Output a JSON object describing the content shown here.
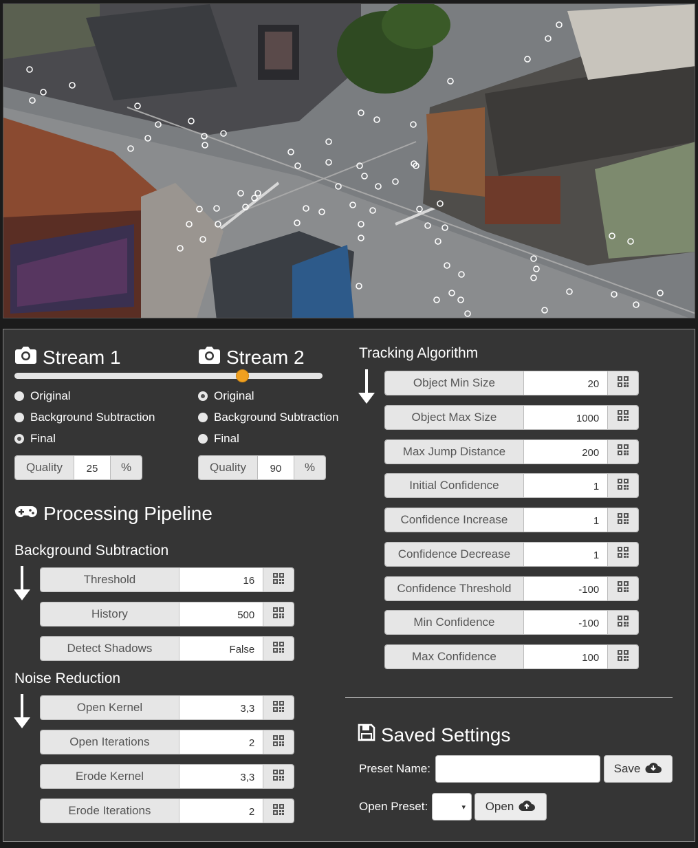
{
  "stream1": {
    "title": "Stream 1",
    "options": [
      "Original",
      "Background Subtraction",
      "Final"
    ],
    "selected": "Final",
    "quality_label": "Quality",
    "quality_value": "25",
    "quality_unit": "%"
  },
  "stream2": {
    "title": "Stream 2",
    "options": [
      "Original",
      "Background Subtraction",
      "Final"
    ],
    "selected": "Original",
    "quality_label": "Quality",
    "quality_value": "90",
    "quality_unit": "%"
  },
  "stream_slider": {
    "value_fraction": 0.74
  },
  "pipeline": {
    "title": "Processing Pipeline",
    "background_subtraction": {
      "title": "Background Subtraction",
      "params": [
        {
          "label": "Threshold",
          "value": "16"
        },
        {
          "label": "History",
          "value": "500"
        },
        {
          "label": "Detect Shadows",
          "value": "False"
        }
      ]
    },
    "noise_reduction": {
      "title": "Noise Reduction",
      "params": [
        {
          "label": "Open Kernel",
          "value": "3,3"
        },
        {
          "label": "Open Iterations",
          "value": "2"
        },
        {
          "label": "Erode Kernel",
          "value": "3,3"
        },
        {
          "label": "Erode Iterations",
          "value": "2"
        }
      ]
    }
  },
  "tracking": {
    "title": "Tracking Algorithm",
    "params": [
      {
        "label": "Object Min Size",
        "value": "20"
      },
      {
        "label": "Object Max Size",
        "value": "1000"
      },
      {
        "label": "Max Jump Distance",
        "value": "200"
      },
      {
        "label": "Initial Confidence",
        "value": "1"
      },
      {
        "label": "Confidence Increase",
        "value": "1"
      },
      {
        "label": "Confidence Decrease",
        "value": "1"
      },
      {
        "label": "Confidence Threshold",
        "value": "-100"
      },
      {
        "label": "Min Confidence",
        "value": "-100"
      },
      {
        "label": "Max Confidence",
        "value": "100"
      }
    ]
  },
  "saved": {
    "title": "Saved Settings",
    "preset_name_label": "Preset Name:",
    "preset_name_value": "",
    "save_label": "Save",
    "open_preset_label": "Open Preset:",
    "open_preset_value": "",
    "open_label": "Open"
  },
  "icons": {
    "camera": "camera-icon",
    "gamepad": "gamepad-icon",
    "floppy": "floppy-disk-icon",
    "qrcode": "qrcode-icon",
    "arrow": "arrow-down-icon",
    "cloud_download": "cloud-download-icon",
    "cloud_upload": "cloud-upload-icon"
  },
  "colors": {
    "panel_bg": "#353535",
    "slider_knob": "#f0a020",
    "param_label_bg": "#e6e6e6"
  }
}
